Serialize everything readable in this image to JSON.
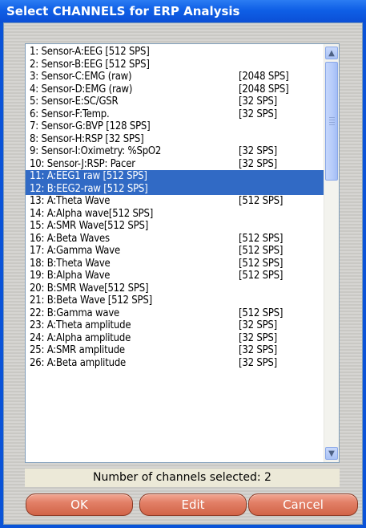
{
  "window": {
    "title": "Select CHANNELS for ERP Analysis"
  },
  "channels": [
    {
      "name": "1: Sensor-A:EEG [512 SPS]",
      "rate": "",
      "selected": false
    },
    {
      "name": "2: Sensor-B:EEG [512 SPS]",
      "rate": "",
      "selected": false
    },
    {
      "name": "3: Sensor-C:EMG (raw)",
      "rate": "[2048 SPS]",
      "selected": false
    },
    {
      "name": "4: Sensor-D:EMG (raw)",
      "rate": "[2048 SPS]",
      "selected": false
    },
    {
      "name": "5: Sensor-E:SC/GSR",
      "rate": "[32 SPS]",
      "selected": false
    },
    {
      "name": "6: Sensor-F:Temp.",
      "rate": "[32 SPS]",
      "selected": false
    },
    {
      "name": "7: Sensor-G:BVP [128 SPS]",
      "rate": "",
      "selected": false
    },
    {
      "name": "8: Sensor-H:RSP [32 SPS]",
      "rate": "",
      "selected": false
    },
    {
      "name": "9: Sensor-I:Oximetry: %SpO2",
      "rate": "[32 SPS]",
      "selected": false
    },
    {
      "name": "10: Sensor-J:RSP: Pacer",
      "rate": "[32 SPS]",
      "selected": false
    },
    {
      "name": "11: A:EEG1 raw   [512 SPS]",
      "rate": "",
      "selected": true
    },
    {
      "name": "12: B:EEG2-raw   [512 SPS]",
      "rate": "",
      "selected": true
    },
    {
      "name": "13: A:Theta Wave",
      "rate": "[512 SPS]",
      "selected": false
    },
    {
      "name": "14: A:Alpha wave[512 SPS]",
      "rate": "",
      "selected": false
    },
    {
      "name": "15: A:SMR Wave[512 SPS]",
      "rate": "",
      "selected": false
    },
    {
      "name": "16: A:Beta Waves",
      "rate": "[512 SPS]",
      "selected": false
    },
    {
      "name": "17: A:Gamma Wave",
      "rate": "[512 SPS]",
      "selected": false
    },
    {
      "name": "18: B:Theta Wave",
      "rate": "[512 SPS]",
      "selected": false
    },
    {
      "name": "19: B:Alpha Wave",
      "rate": "[512 SPS]",
      "selected": false
    },
    {
      "name": "20: B:SMR Wave[512 SPS]",
      "rate": "",
      "selected": false
    },
    {
      "name": "21: B:Beta Wave [512 SPS]",
      "rate": "",
      "selected": false
    },
    {
      "name": "22: B:Gamma wave",
      "rate": "[512 SPS]",
      "selected": false
    },
    {
      "name": "23: A:Theta amplitude",
      "rate": "[32 SPS]",
      "selected": false
    },
    {
      "name": "24: A:Alpha amplitude",
      "rate": "[32 SPS]",
      "selected": false
    },
    {
      "name": "25: A:SMR amplitude",
      "rate": "[32 SPS]",
      "selected": false
    },
    {
      "name": "26: A:Beta amplitude",
      "rate": "[32 SPS]",
      "selected": false
    }
  ],
  "scrollbar": {
    "up_icon": "arrow-up-icon",
    "down_icon": "arrow-down-icon"
  },
  "status": {
    "text": "Number of channels selected: 2"
  },
  "buttons": {
    "ok": "OK",
    "edit": "Edit",
    "cancel": "Cancel"
  },
  "colors": {
    "selection": "#316ac5",
    "titlebar": "#0f5fe6",
    "button": "#e27f66"
  }
}
